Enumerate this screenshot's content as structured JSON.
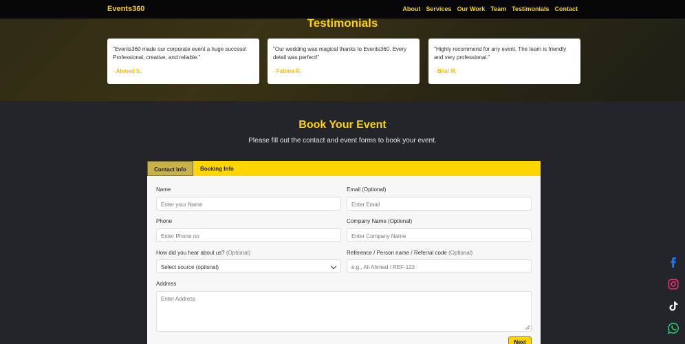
{
  "nav": {
    "brand": "Events360",
    "links": [
      "About",
      "Services",
      "Our Work",
      "Team",
      "Testimonials",
      "Contact"
    ]
  },
  "testimonials": {
    "title": "Testimonials",
    "items": [
      {
        "quote": "\"Events360 made our corporate event a huge success! Professional, creative, and reliable.\"",
        "author": "- Ahmed S."
      },
      {
        "quote": "\"Our wedding was magical thanks to Events360. Every detail was perfect!\"",
        "author": "- Fatima R."
      },
      {
        "quote": "\"Highly recommend for any event. The team is friendly and very professional.\"",
        "author": "- Bilal M."
      }
    ]
  },
  "booking": {
    "title": "Book Your Event",
    "subtitle": "Please fill out the contact and event forms to book your event.",
    "tabs": [
      "Contact Info",
      "Booking Info"
    ],
    "fields": {
      "name": {
        "label": "Name",
        "placeholder": "Enter your Name"
      },
      "email": {
        "label": "Email (Optional)",
        "placeholder": "Enter Email"
      },
      "phone": {
        "label": "Phone",
        "placeholder": "Enter Phone no"
      },
      "company": {
        "label": "Company Name (Optional)",
        "placeholder": "Enter Company Name"
      },
      "source": {
        "label": "How did you hear about us?",
        "optional": "(Optional)",
        "selected": "Select source (optional)"
      },
      "reference": {
        "label": "Reference / Person name / Referral code",
        "optional": "(Optional)",
        "placeholder": "e.g., Ali Ahmed / REF-123"
      },
      "address": {
        "label": "Address",
        "placeholder": "Enter Address"
      }
    },
    "next_label": "Next"
  },
  "colors": {
    "accent": "#ffd400",
    "facebook": "#1877f2",
    "instagram": "#e1306c",
    "whatsapp": "#25d366"
  },
  "social_icons": [
    "facebook-icon",
    "instagram-icon",
    "tiktok-icon",
    "whatsapp-icon"
  ]
}
